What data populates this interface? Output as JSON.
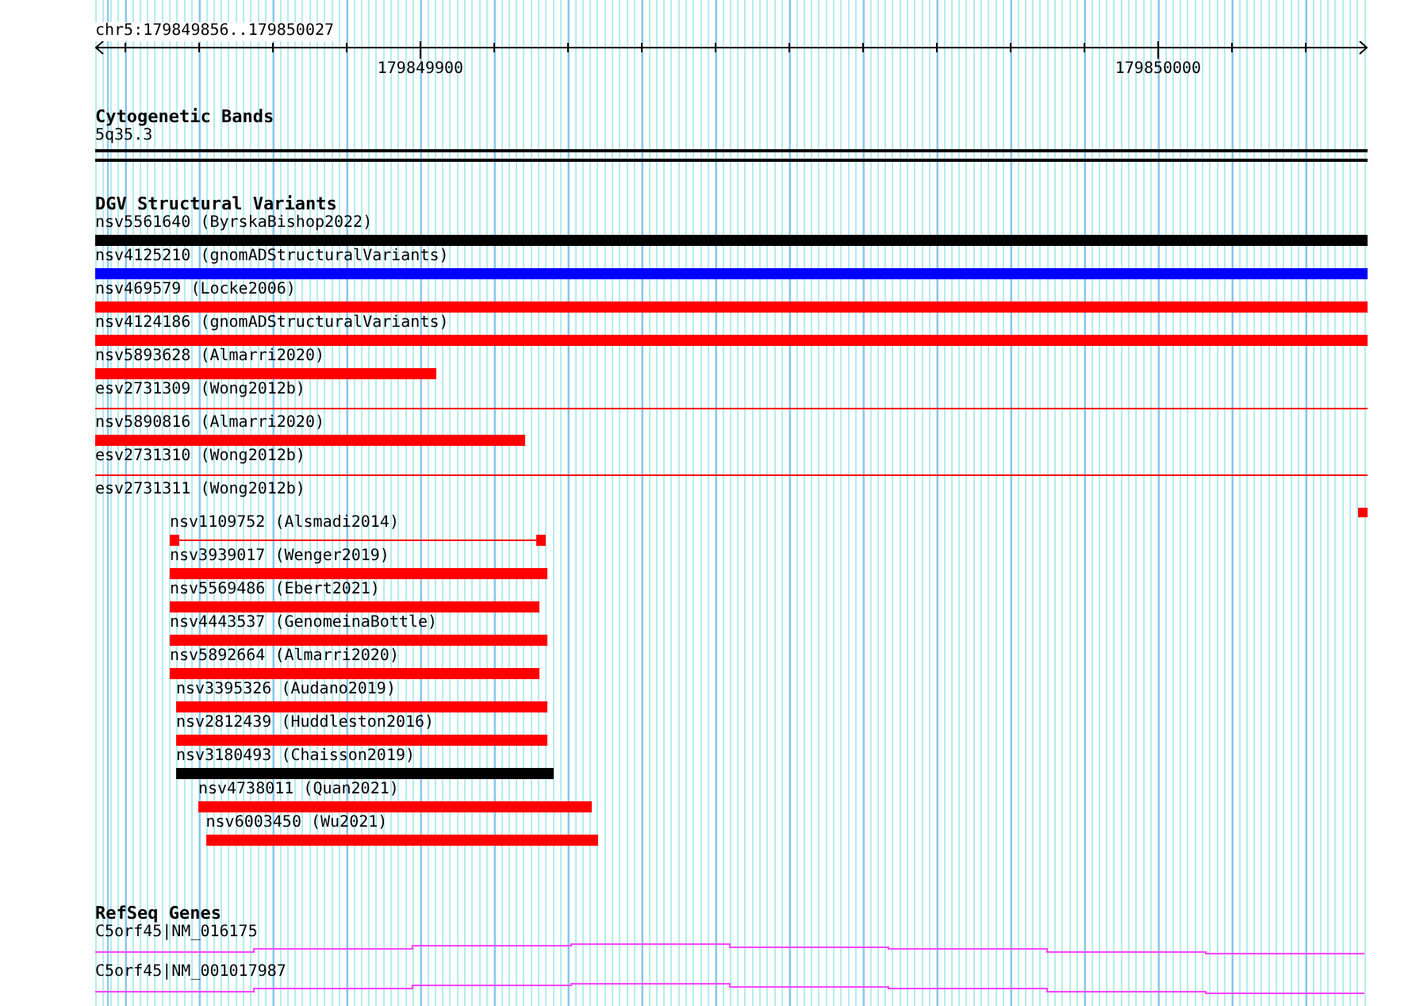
{
  "ruler": {
    "location": "chr5:179849856..179850027",
    "labels": [
      {
        "text": "179849900"
      },
      {
        "text": "179850000"
      }
    ]
  },
  "cytogenetic_bands": {
    "title": "Cytogenetic Bands",
    "band": "5q35.3"
  },
  "dgv_structural_variants": {
    "title": "DGV Structural Variants",
    "features": [
      {
        "label": "nsv5561640 (ByrskaBishop2022)",
        "kind": "bar",
        "color": "#000000"
      },
      {
        "label": "nsv4125210 (gnomADStructuralVariants)",
        "kind": "bar",
        "color": "#0000ff"
      },
      {
        "label": "nsv469579 (Locke2006)",
        "kind": "bar",
        "color": "#ff0000"
      },
      {
        "label": "nsv4124186 (gnomADStructuralVariants)",
        "kind": "bar",
        "color": "#ff0000"
      },
      {
        "label": "nsv5893628 (Almarri2020)",
        "kind": "bar",
        "color": "#ff0000"
      },
      {
        "label": "esv2731309 (Wong2012b)",
        "kind": "line",
        "color": "#ff0000"
      },
      {
        "label": "nsv5890816 (Almarri2020)",
        "kind": "bar",
        "color": "#ff0000"
      },
      {
        "label": "esv2731310 (Wong2012b)",
        "kind": "line",
        "color": "#ff0000"
      },
      {
        "label": "esv2731311 (Wong2012b)",
        "kind": "block",
        "color": "#ff0000"
      },
      {
        "label": "nsv1109752 (Alsmadi2014)",
        "kind": "split",
        "color": "#ff0000"
      },
      {
        "label": "nsv3939017 (Wenger2019)",
        "kind": "bar",
        "color": "#ff0000"
      },
      {
        "label": "nsv5569486 (Ebert2021)",
        "kind": "bar",
        "color": "#ff0000"
      },
      {
        "label": "nsv4443537 (GenomeinaBottle)",
        "kind": "bar",
        "color": "#ff0000"
      },
      {
        "label": "nsv5892664 (Almarri2020)",
        "kind": "bar",
        "color": "#ff0000"
      },
      {
        "label": "nsv3395326 (Audano2019)",
        "kind": "bar",
        "color": "#ff0000"
      },
      {
        "label": "nsv2812439 (Huddleston2016)",
        "kind": "bar",
        "color": "#ff0000"
      },
      {
        "label": "nsv3180493 (Chaisson2019)",
        "kind": "bar",
        "color": "#000000"
      },
      {
        "label": "nsv4738011 (Quan2021)",
        "kind": "bar",
        "color": "#ff0000"
      },
      {
        "label": "nsv6003450 (Wu2021)",
        "kind": "bar",
        "color": "#ff0000"
      }
    ]
  },
  "refseq_genes": {
    "title": "RefSeq Genes",
    "transcripts": [
      {
        "label": "C5orf45|NM_016175"
      },
      {
        "label": "C5orf45|NM_001017987"
      }
    ]
  }
}
